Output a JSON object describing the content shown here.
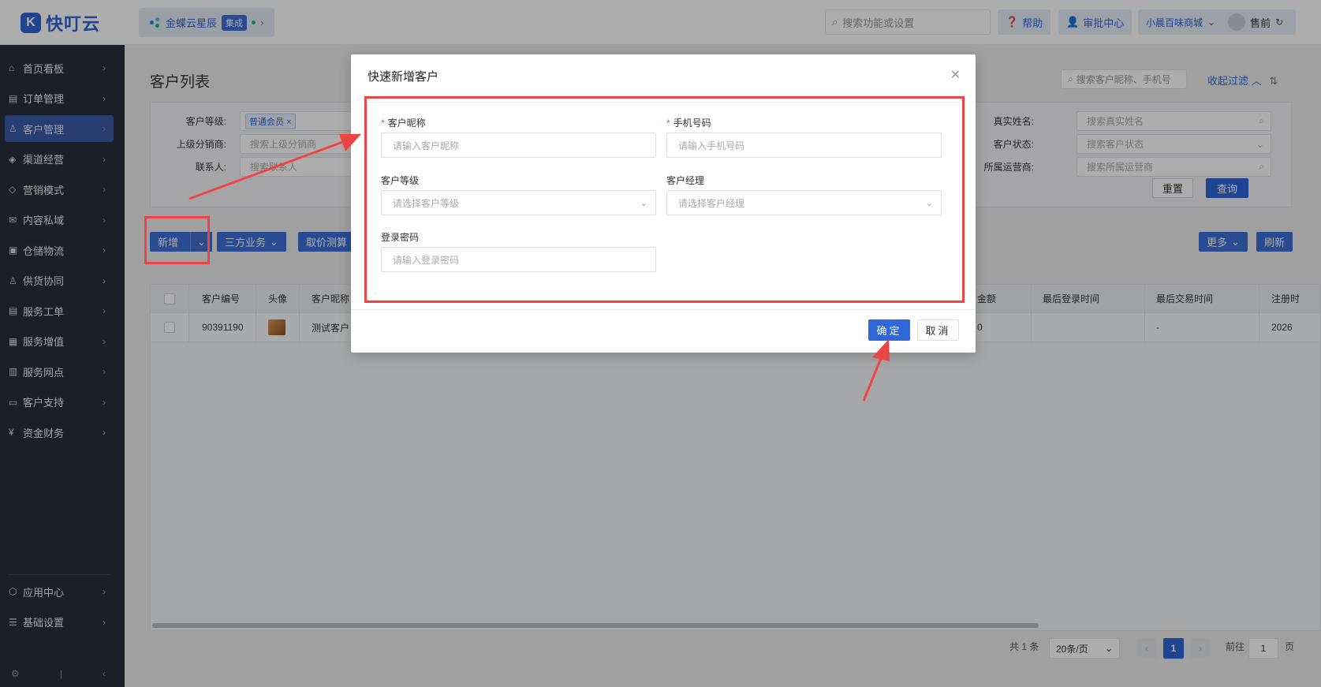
{
  "brand": {
    "name": "快叮云",
    "mark": "K"
  },
  "header": {
    "integration_name": "金蝶云星辰",
    "integration_badge": "集成",
    "search_placeholder": "搜索功能或设置",
    "help_label": "帮助",
    "approval_label": "审批中心",
    "shop_name": "小晨百味商城",
    "user_name": "售前"
  },
  "sidebar": {
    "items": [
      {
        "label": "首页看板",
        "icon": "dashboard-icon",
        "glyph": "⌂"
      },
      {
        "label": "订单管理",
        "icon": "order-icon",
        "glyph": "▤"
      },
      {
        "label": "客户管理",
        "icon": "customer-icon",
        "glyph": "♙"
      },
      {
        "label": "渠道经营",
        "icon": "channel-icon",
        "glyph": "◈"
      },
      {
        "label": "营销模式",
        "icon": "marketing-icon",
        "glyph": "◇"
      },
      {
        "label": "内容私域",
        "icon": "content-icon",
        "glyph": "✉"
      },
      {
        "label": "仓储物流",
        "icon": "warehouse-icon",
        "glyph": "▣"
      },
      {
        "label": "供货协同",
        "icon": "supply-icon",
        "glyph": "♙"
      },
      {
        "label": "服务工单",
        "icon": "ticket-icon",
        "glyph": "▤"
      },
      {
        "label": "服务增值",
        "icon": "value-added-icon",
        "glyph": "▦"
      },
      {
        "label": "服务网点",
        "icon": "outlet-icon",
        "glyph": "▥"
      },
      {
        "label": "客户支持",
        "icon": "support-icon",
        "glyph": "▭"
      },
      {
        "label": "资金财务",
        "icon": "finance-icon",
        "glyph": "¥"
      }
    ],
    "bottom_items": [
      {
        "label": "应用中心",
        "icon": "app-center-icon",
        "glyph": "⬡"
      },
      {
        "label": "基础设置",
        "icon": "settings-icon",
        "glyph": "☰"
      }
    ]
  },
  "page": {
    "title": "客户列表",
    "quick_search_placeholder": "搜索客户昵称、手机号",
    "collapse_label": "收起过滤"
  },
  "filters": {
    "level_label": "客户等级:",
    "level_tag": "普通会员",
    "distributor_label": "上级分销商:",
    "distributor_placeholder": "搜索上级分销商",
    "contact_label": "联系人:",
    "contact_placeholder": "搜索联系人",
    "realname_label": "真实姓名:",
    "realname_placeholder": "搜索真实姓名",
    "status_label": "客户状态:",
    "status_placeholder": "搜索客户状态",
    "operator_label": "所属运营商:",
    "operator_placeholder": "搜索所属运营商",
    "reset_label": "重置",
    "query_label": "查询"
  },
  "actions": {
    "add_label": "新增",
    "third_party_label": "三方业务",
    "price_label": "取价测算",
    "more_label": "更多",
    "refresh_label": "刷新"
  },
  "table": {
    "headers": [
      "客户编号",
      "头像",
      "客户昵称",
      "金额",
      "最后登录时间",
      "最后交易时间",
      "注册时"
    ],
    "rows": [
      {
        "id": "90391190",
        "nickname": "测试客户",
        "amount": "0",
        "last_login": "",
        "last_trade": "-",
        "registered": "2026"
      }
    ]
  },
  "pagination": {
    "total": "共 1 条",
    "page_size": "20条/页",
    "current_page": "1",
    "goto_label": "前往",
    "goto_value": "1",
    "page_unit": "页"
  },
  "dialog": {
    "title": "快速新增客户",
    "nickname_label": "客户昵称",
    "nickname_placeholder": "请输入客户昵称",
    "phone_label": "手机号码",
    "phone_placeholder": "请输入手机号码",
    "level_label": "客户等级",
    "level_placeholder": "请选择客户等级",
    "manager_label": "客户经理",
    "manager_placeholder": "请选择客户经理",
    "password_label": "登录密码",
    "password_placeholder": "请输入登录密码",
    "ok_label": "确定",
    "cancel_label": "取消"
  },
  "colors": {
    "primary": "#2f66d8",
    "sidebar_bg": "#2b2f3c",
    "annotation": "#ee4444"
  }
}
